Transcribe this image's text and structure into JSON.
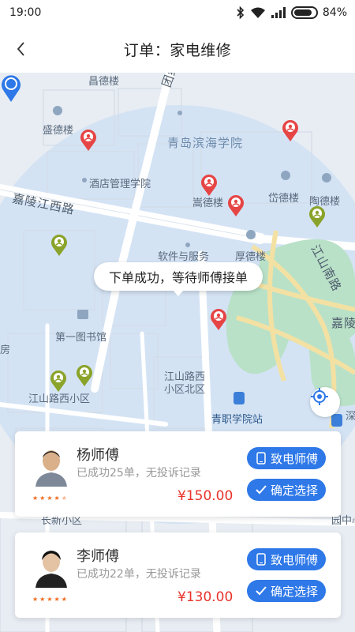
{
  "status_bar": {
    "time": "19:00",
    "battery": "84%"
  },
  "nav": {
    "title": "订单：家电维修"
  },
  "map": {
    "labels": {
      "changde": "昌德楼",
      "tuanjie_road": "团结路",
      "shengde": "盛德楼",
      "qingdao_binhai": "青岛滨海学院",
      "hotel_mgmt": "酒店管理学院",
      "songde": "嵩德楼",
      "daide": "岱德楼",
      "taode": "陶德楼",
      "jialingjiang_road": "嘉陵江西路",
      "software": "软件与服务",
      "houde": "厚德楼",
      "jiangshan_road": "江山南路",
      "library": "第一图书馆",
      "jialing_short": "嘉陵",
      "fang": "房",
      "jiangshan_north": "江山路西\n小区北区",
      "jiangshan_west": "江山路西小区",
      "qingzhi_station": "青职学院站",
      "shen": "深",
      "changxin": "长新小区",
      "park": "园中心"
    },
    "status_bubble": "下单成功，等待师傅接单"
  },
  "masters": [
    {
      "name": "杨师傅",
      "description": "已成功25单，无投诉记录",
      "price": "¥150.00",
      "rating": 4.5,
      "call_label": "致电师傅",
      "confirm_label": "确定选择"
    },
    {
      "name": "李师傅",
      "description": "已成功22单，无投诉记录",
      "price": "¥130.00",
      "rating": 5,
      "call_label": "致电师傅",
      "confirm_label": "确定选择"
    }
  ],
  "colors": {
    "accent": "#2e78e8",
    "price": "#e8332a",
    "pin_red": "#e64545",
    "pin_green": "#8aa32a",
    "star": "#f06b1e"
  }
}
